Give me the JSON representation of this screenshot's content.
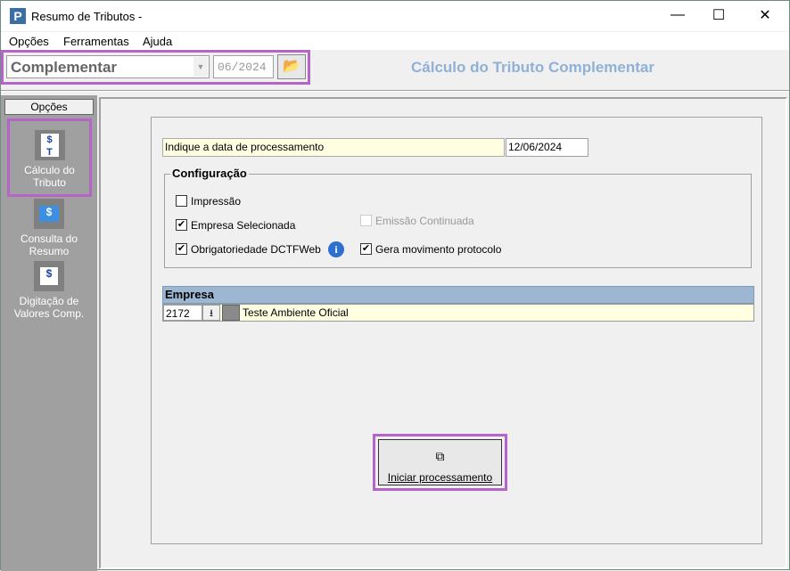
{
  "window": {
    "title": "Resumo de Tributos -",
    "controls": {
      "minimize": "—",
      "maximize": "☐",
      "close": "✕"
    }
  },
  "menu": [
    "Opções",
    "Ferramentas",
    "Ajuda"
  ],
  "toolbar": {
    "type_value": "Complementar",
    "period_value": "06/2024"
  },
  "page_title": "Cálculo do Tributo Complementar",
  "sidebar": {
    "header": "Opções",
    "items": [
      {
        "label": "Cálculo do Tributo",
        "selected": true
      },
      {
        "label": "Consulta do Resumo"
      },
      {
        "label": "Digitação de Valores Comp."
      }
    ]
  },
  "form": {
    "date_label": "Indique a data de processamento",
    "date_value": "12/06/2024",
    "config": {
      "title": "Configuração",
      "impressao": {
        "label": "Impressão",
        "checked": false
      },
      "empresa_sel": {
        "label": "Empresa Selecionada",
        "checked": true
      },
      "emissao": {
        "label": "Emissão Continuada",
        "checked": false,
        "disabled": true
      },
      "obrig": {
        "label": "Obrigatoriedade DCTFWeb",
        "checked": true
      },
      "gera": {
        "label": "Gera movimento protocolo",
        "checked": true
      }
    },
    "empresa": {
      "header": "Empresa",
      "code": "2172",
      "name": "Teste Ambiente Oficial"
    },
    "start_button": "Iniciar processamento"
  },
  "colors": {
    "highlight": "#b565c9",
    "title_blue": "#8fb1d6",
    "header_blue": "#9db7d3",
    "field_yellow": "#ffffe1",
    "sidebar": "#a0a0a0"
  }
}
